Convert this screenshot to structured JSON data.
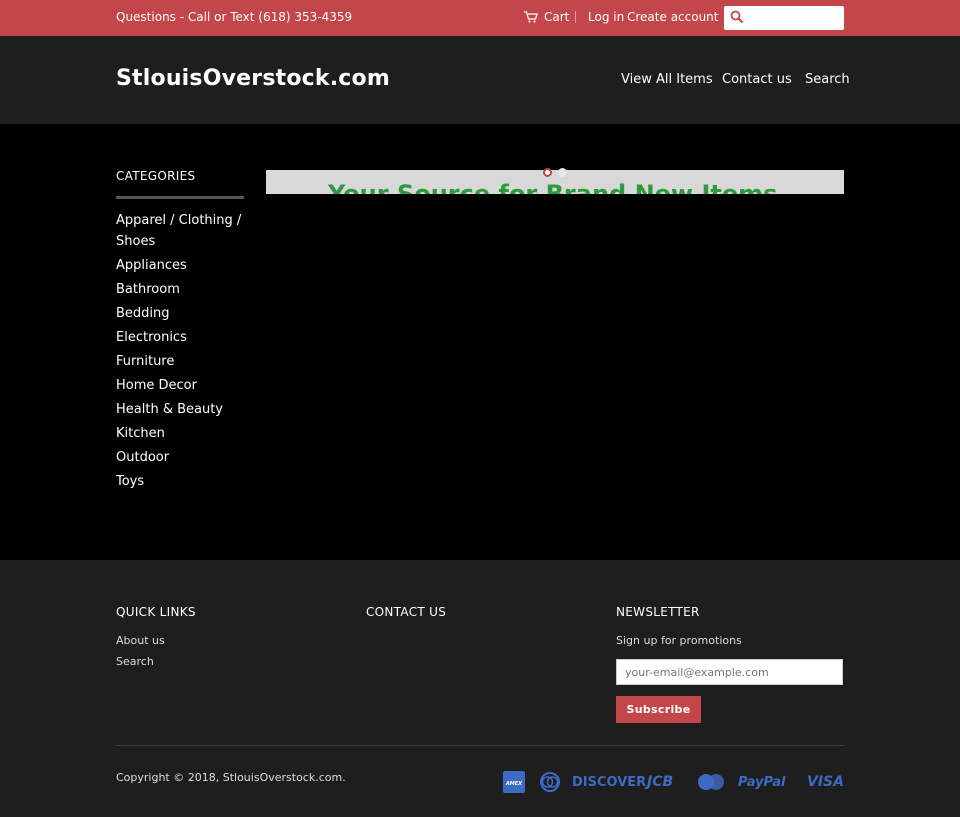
{
  "topbar": {
    "phone": "Questions - Call or Text (618) 353-4359",
    "cart": "Cart",
    "login": "Log in",
    "create_account": "Create account",
    "search_placeholder": "",
    "cart_icon": "cart-icon",
    "search_icon": "search-icon"
  },
  "header": {
    "logo": "StlouisOverstock.com",
    "nav": [
      "View All Items",
      "Contact us",
      "Search"
    ]
  },
  "sidebar": {
    "title": "CATEGORIES",
    "items": [
      "Apparel / Clothing / Shoes",
      "Appliances",
      "Bathroom",
      "Bedding",
      "Electronics",
      "Furniture",
      "Home Decor",
      "Health & Beauty",
      "Kitchen",
      "Outdoor",
      "Toys"
    ]
  },
  "slider": {
    "tagline": "Your Source for Brand New Items"
  },
  "footer": {
    "quick_links_title": "QUICK LINKS",
    "quick_links": [
      "About us",
      "Search"
    ],
    "contact_title": "CONTACT US",
    "newsletter_title": "NEWSLETTER",
    "newsletter_text": "Sign up for promotions",
    "email_placeholder": "your-email@example.com",
    "subscribe": "Subscribe",
    "copyright": "Copyright © 2018, StlouisOverstock.com.",
    "payments": [
      "AMEX",
      "Diners",
      "DISCOVER",
      "JCB",
      "MasterCard",
      "PayPal",
      "VISA"
    ]
  },
  "colors": {
    "accent": "#c3464a",
    "header_bg": "#1e1e1e",
    "body_bg": "#000000",
    "tagline": "#2f9a3c",
    "payment_blue": "#3d6bc4"
  }
}
